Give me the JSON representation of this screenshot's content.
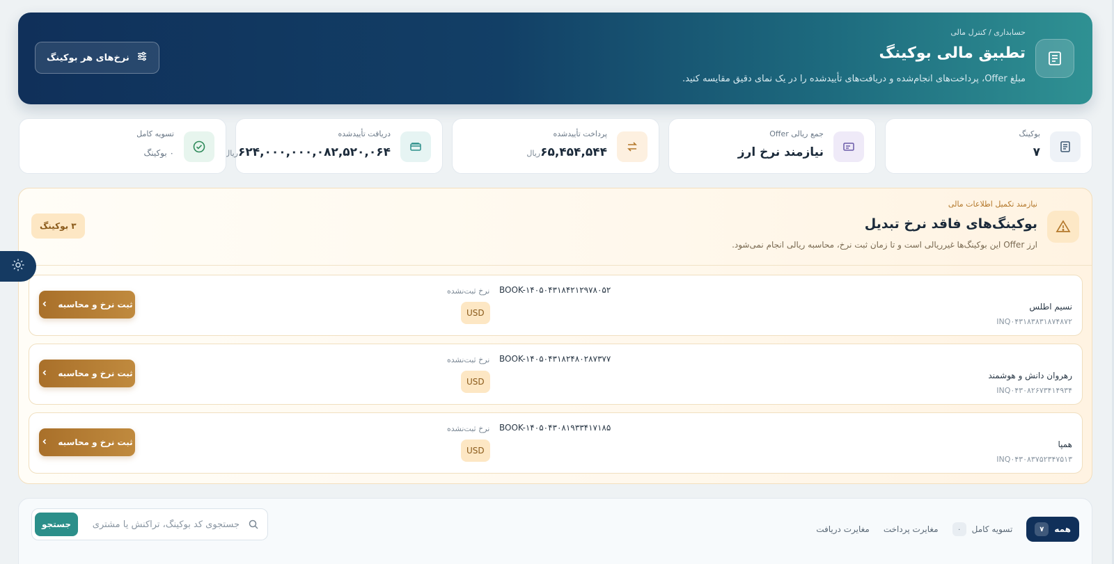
{
  "header": {
    "breadcrumb": "حسابداری / کنترل مالی",
    "title": "تطبیق مالی بوکینگ",
    "description": "مبلغ Offer، پرداخت‌های انجام‌شده و دریافت‌های تأییدشده را در یک نمای دقیق مقایسه کنید.",
    "rates_button": "نرخ‌های هر بوکینگ"
  },
  "stats": [
    {
      "label": "بوکینگ",
      "value": "۷",
      "unit": "",
      "icon": "document-icon"
    },
    {
      "label": "جمع ریالی Offer",
      "value": "نیازمند نرخ ارز",
      "unit": "",
      "icon": "card-icon"
    },
    {
      "label": "پرداخت تأییدشده",
      "value": "۶۵,۴۵۴,۵۴۴",
      "unit": "ریال",
      "icon": "swap-arrows-icon"
    },
    {
      "label": "دریافت تأییدشده",
      "value": "۶۲۴,۰۰۰,۰۰۰,۰۸۲,۵۲۰,۰۶۴",
      "unit": "ریال",
      "icon": "wallet-icon"
    },
    {
      "label": "تسویه کامل",
      "value": "۰ بوکینگ",
      "unit": "",
      "icon": "check-circle-icon"
    }
  ],
  "alert": {
    "eyebrow": "نیازمند تکمیل اطلاعات مالی",
    "title": "بوکینگ‌های فاقد نرخ تبدیل",
    "description": "ارز Offer این بوکینگ‌ها غیرریالی است و تا زمان ثبت نرخ، محاسبه ریالی انجام نمی‌شود.",
    "count": "۳ بوکینگ",
    "rows": [
      {
        "customer": "نسیم اطلس",
        "inquiry": "INQ۰۴۳۱۸۳۸۳۱۸۷۴۸۷۲",
        "booking": "BOOK-۱۴۰۵۰۴۳۱۸۴۲۱۲۹۷۸۰۵۲",
        "rate_status": "نرخ ثبت‌نشده",
        "currency": "USD",
        "action": "ثبت نرخ و محاسبه"
      },
      {
        "customer": "رهروان دانش و هوشمند",
        "inquiry": "INQ۰۴۳۰۸۲۶۷۳۴۱۴۹۳۴",
        "booking": "BOOK-۱۴۰۵۰۴۳۱۸۲۴۸۰۲۸۷۳۷۷",
        "rate_status": "نرخ ثبت‌نشده",
        "currency": "USD",
        "action": "ثبت نرخ و محاسبه"
      },
      {
        "customer": "همپا",
        "inquiry": "INQ۰۴۳۰۸۳۷۵۲۳۴۷۵۱۳",
        "booking": "BOOK-۱۴۰۵۰۴۳۰۸۱۹۳۳۴۱۷۱۸۵",
        "rate_status": "نرخ ثبت‌نشده",
        "currency": "USD",
        "action": "ثبت نرخ و محاسبه"
      }
    ]
  },
  "filters": {
    "tabs": [
      {
        "label": "همه",
        "count": "۷",
        "active": true
      },
      {
        "label": "تسویه کامل",
        "count": "۰",
        "active": false
      },
      {
        "label": "مغایرت پرداخت",
        "count": "",
        "active": false
      },
      {
        "label": "مغایرت دریافت",
        "count": "",
        "active": false
      }
    ],
    "search_placeholder": "جستجوی کد بوکینگ، تراکنش یا مشتری",
    "search_button": "جستجو"
  },
  "colors": {
    "hero_start": "#10305a",
    "hero_end": "#2f9193",
    "warning_accent": "#b3772a",
    "action_button": "#a9702a",
    "search_button": "#2c8f8a"
  }
}
